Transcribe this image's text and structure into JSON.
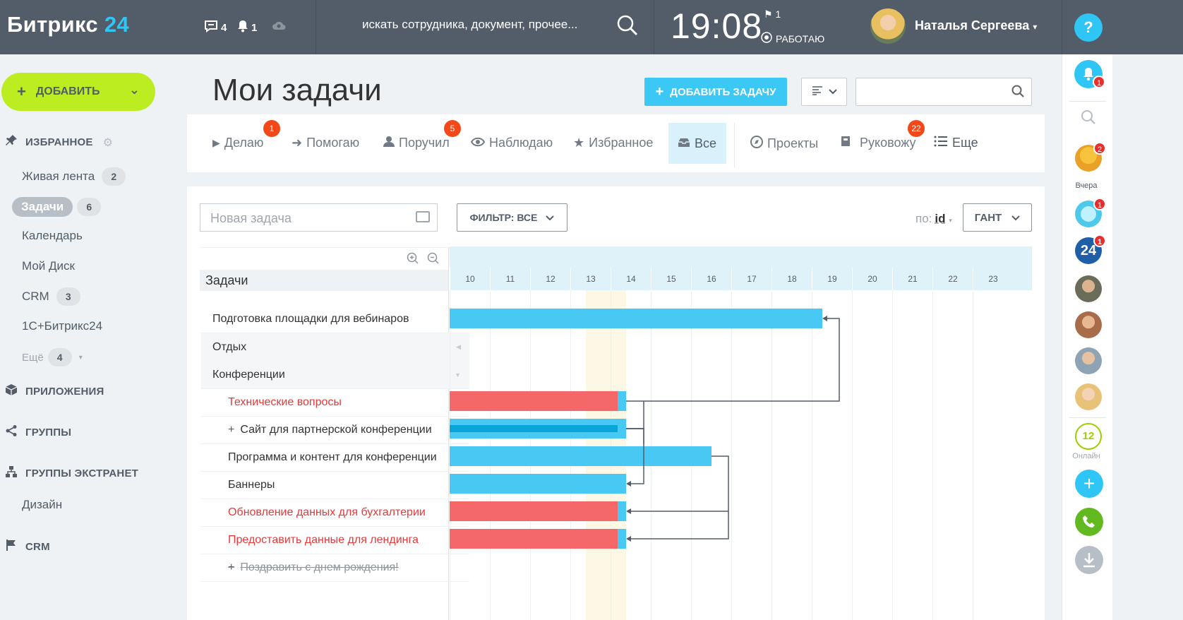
{
  "topbar": {
    "logo": "Битрикс",
    "logo_num": "24",
    "messages_count": "4",
    "notifications_count": "1",
    "search_placeholder": "искать сотрудника, документ, прочее...",
    "time": "19:08",
    "flag_count": "1",
    "status": "РАБОТАЮ",
    "user_name": "Наталья Сергеева",
    "help": "?"
  },
  "sidebar": {
    "add_button": "ДОБАВИТЬ",
    "favorites": "ИЗБРАННОЕ",
    "items": [
      {
        "label": "Живая лента",
        "count": "2"
      },
      {
        "label": "Задачи",
        "count": "6"
      },
      {
        "label": "Календарь"
      },
      {
        "label": "Мой Диск"
      },
      {
        "label": "CRM",
        "count": "3"
      },
      {
        "label": "1С+Битрикс24"
      },
      {
        "label": "Ещё",
        "count": "4"
      }
    ],
    "apps": "ПРИЛОЖЕНИЯ",
    "groups": "ГРУППЫ",
    "extranet": "ГРУППЫ ЭКСТРАНЕТ",
    "design": "Дизайн",
    "crm": "CRM"
  },
  "page": {
    "title": "Мои задачи",
    "add_task": "ДОБАВИТЬ ЗАДАЧУ"
  },
  "tabs": [
    {
      "label": "Делаю",
      "badge": "1"
    },
    {
      "label": "Помогаю"
    },
    {
      "label": "Поручил",
      "badge": "5"
    },
    {
      "label": "Наблюдаю"
    },
    {
      "label": "Избранное"
    },
    {
      "label": "Все"
    },
    {
      "label": "Проекты"
    },
    {
      "label": "Руковожу",
      "badge": "22"
    },
    {
      "label": "Еще"
    }
  ],
  "toolbar": {
    "new_task_placeholder": "Новая задача",
    "filter": "ФИЛЬТР: ВСЕ",
    "sort_label": "по:",
    "sort_value": "id",
    "view": "ГАНТ"
  },
  "gantt": {
    "tasks_header": "Задачи",
    "hours": [
      "10",
      "11",
      "12",
      "13",
      "14",
      "15",
      "16",
      "17",
      "18",
      "19",
      "20",
      "21",
      "22",
      "23"
    ],
    "rows": [
      {
        "label": "Подготовка площадки для вебинаров"
      },
      {
        "label": "Отдых"
      },
      {
        "label": "Конференции"
      },
      {
        "label": "Технические вопросы"
      },
      {
        "label": "Сайт для партнерской конференции"
      },
      {
        "label": "Программа и контент для конференции"
      },
      {
        "label": "Баннеры"
      },
      {
        "label": "Обновление данных для бухгалтерии"
      },
      {
        "label": "Предоставить данные для лендинга"
      },
      {
        "label": "Поздравить с днем рождения!"
      }
    ]
  },
  "rightbar": {
    "notif_badge": "1",
    "yesterday": "Вчера",
    "chat1_badge": "2",
    "chat2_badge": "1",
    "chat3_badge": "1",
    "b24": "24",
    "online_count": "12",
    "online_label": "Онлайн"
  }
}
